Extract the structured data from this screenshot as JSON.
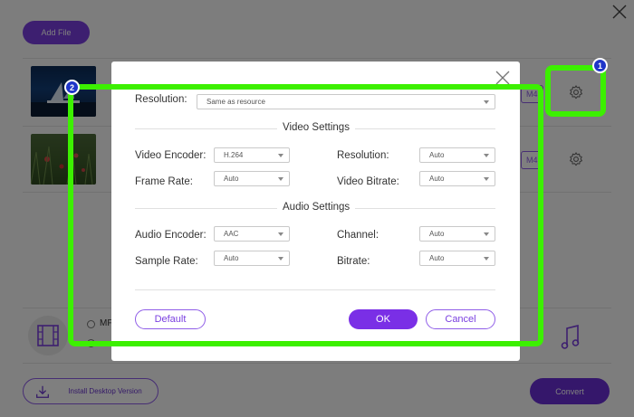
{
  "header": {
    "add_file_label": "Add File"
  },
  "files": [
    {
      "format_tag": "M4",
      "thumbnail": "video-thumbnail-underwater"
    },
    {
      "format_tag": "M4",
      "thumbnail": "video-thumbnail-field"
    }
  ],
  "bottom": {
    "video_tab_text": "MF",
    "install_label": "Install Desktop Version",
    "convert_label": "Convert"
  },
  "modal": {
    "resolution_label": "Resolution:",
    "resolution_value": "Same as resource",
    "video_section_title": "Video Settings",
    "video_encoder_label": "Video Encoder:",
    "video_encoder_value": "H.264",
    "video_resolution_label": "Resolution:",
    "video_resolution_value": "Auto",
    "frame_rate_label": "Frame Rate:",
    "frame_rate_value": "Auto",
    "video_bitrate_label": "Video Bitrate:",
    "video_bitrate_value": "Auto",
    "audio_section_title": "Audio Settings",
    "audio_encoder_label": "Audio Encoder:",
    "audio_encoder_value": "AAC",
    "channel_label": "Channel:",
    "channel_value": "Auto",
    "sample_rate_label": "Sample Rate:",
    "sample_rate_value": "Auto",
    "bitrate_label": "Bitrate:",
    "bitrate_value": "Auto",
    "default_label": "Default",
    "ok_label": "OK",
    "cancel_label": "Cancel"
  },
  "annotations": {
    "badge_1": "1",
    "badge_2": "2",
    "highlight_color": "#3cf000",
    "badge_color": "#1f35c9"
  },
  "colors": {
    "accent": "#7a3fe0",
    "overlay": "rgba(0,0,0,0.5)"
  }
}
